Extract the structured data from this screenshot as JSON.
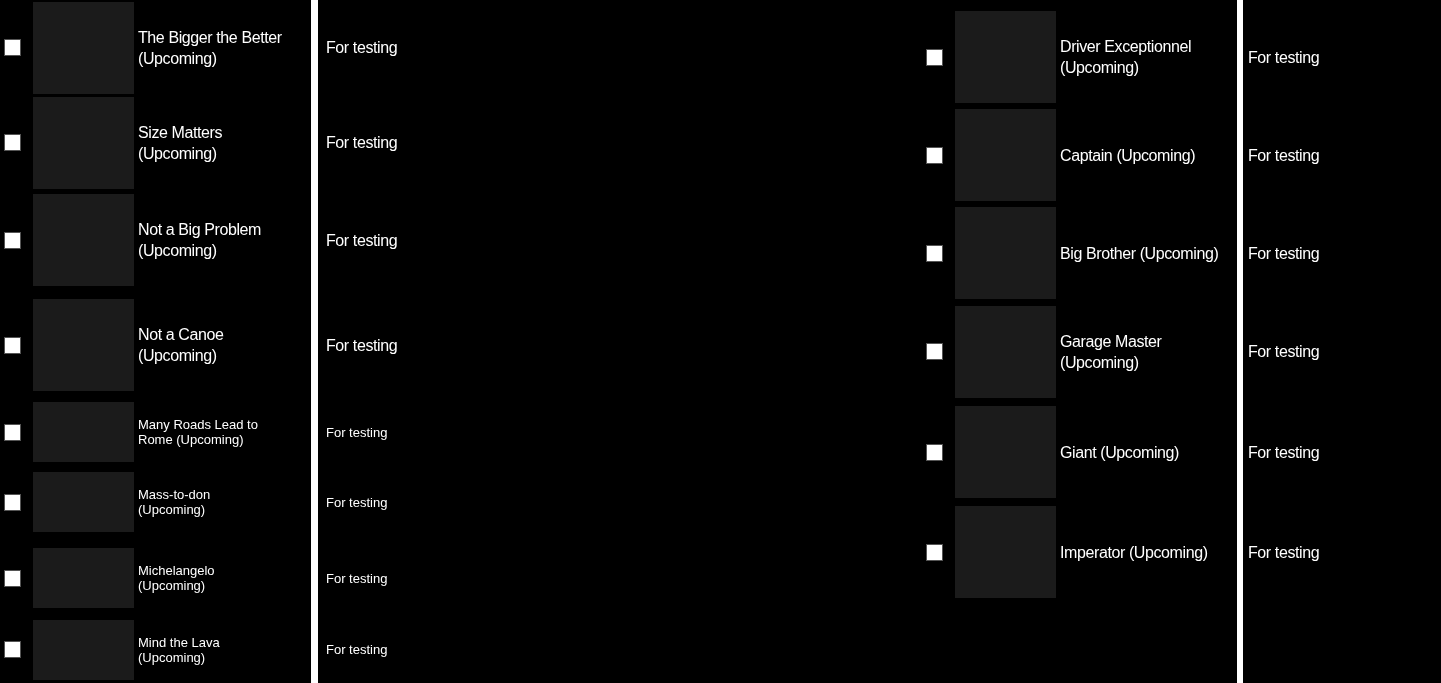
{
  "left_list": {
    "items": [
      {
        "kind": "large",
        "checked": false,
        "title": "The Bigger the Better (Upcoming)",
        "description": "For testing"
      },
      {
        "kind": "large",
        "checked": false,
        "title": "Size Matters (Upcoming)",
        "description": "For testing"
      },
      {
        "kind": "large",
        "checked": false,
        "title": "Not a Big Problem (Upcoming)",
        "description": "For testing"
      },
      {
        "kind": "large",
        "checked": false,
        "title": "Not a Canoe (Upcoming)",
        "description": "For testing"
      },
      {
        "kind": "small",
        "checked": false,
        "title": "Many Roads Lead to Rome (Upcoming)",
        "description": "For testing"
      },
      {
        "kind": "small",
        "checked": false,
        "title": "Mass-to-don (Upcoming)",
        "description": "For testing"
      },
      {
        "kind": "small",
        "checked": false,
        "title": "Michelangelo (Upcoming)",
        "description": "For testing"
      },
      {
        "kind": "small",
        "checked": false,
        "title": "Mind the Lava (Upcoming)",
        "description": "For testing"
      }
    ]
  },
  "right_list": {
    "items": [
      {
        "kind": "large",
        "checked": false,
        "title": "Driver Exceptionnel (Upcoming)",
        "description": "For testing"
      },
      {
        "kind": "large",
        "checked": false,
        "title": "Captain (Upcoming)",
        "description": "For testing"
      },
      {
        "kind": "large",
        "checked": false,
        "title": "Big Brother (Upcoming)",
        "description": "For testing"
      },
      {
        "kind": "large",
        "checked": false,
        "title": "Garage Master (Upcoming)",
        "description": "For testing"
      },
      {
        "kind": "large",
        "checked": false,
        "title": "Giant (Upcoming)",
        "description": "For testing"
      },
      {
        "kind": "large",
        "checked": false,
        "title": "Imperator (Upcoming)",
        "description": "For testing"
      }
    ]
  }
}
